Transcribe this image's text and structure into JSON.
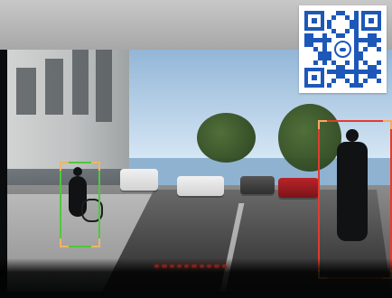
{
  "scene": {
    "detections": [
      {
        "name": "pedestrian-with-stroller",
        "color": "#4ec93b"
      },
      {
        "name": "pedestrian-crossing",
        "color": "#e43b2f"
      }
    ],
    "warning_dots_count": 10,
    "warning_color": "#ff3b2f",
    "qr_code": {
      "present": true,
      "accent_color": "#1d58b8"
    }
  }
}
